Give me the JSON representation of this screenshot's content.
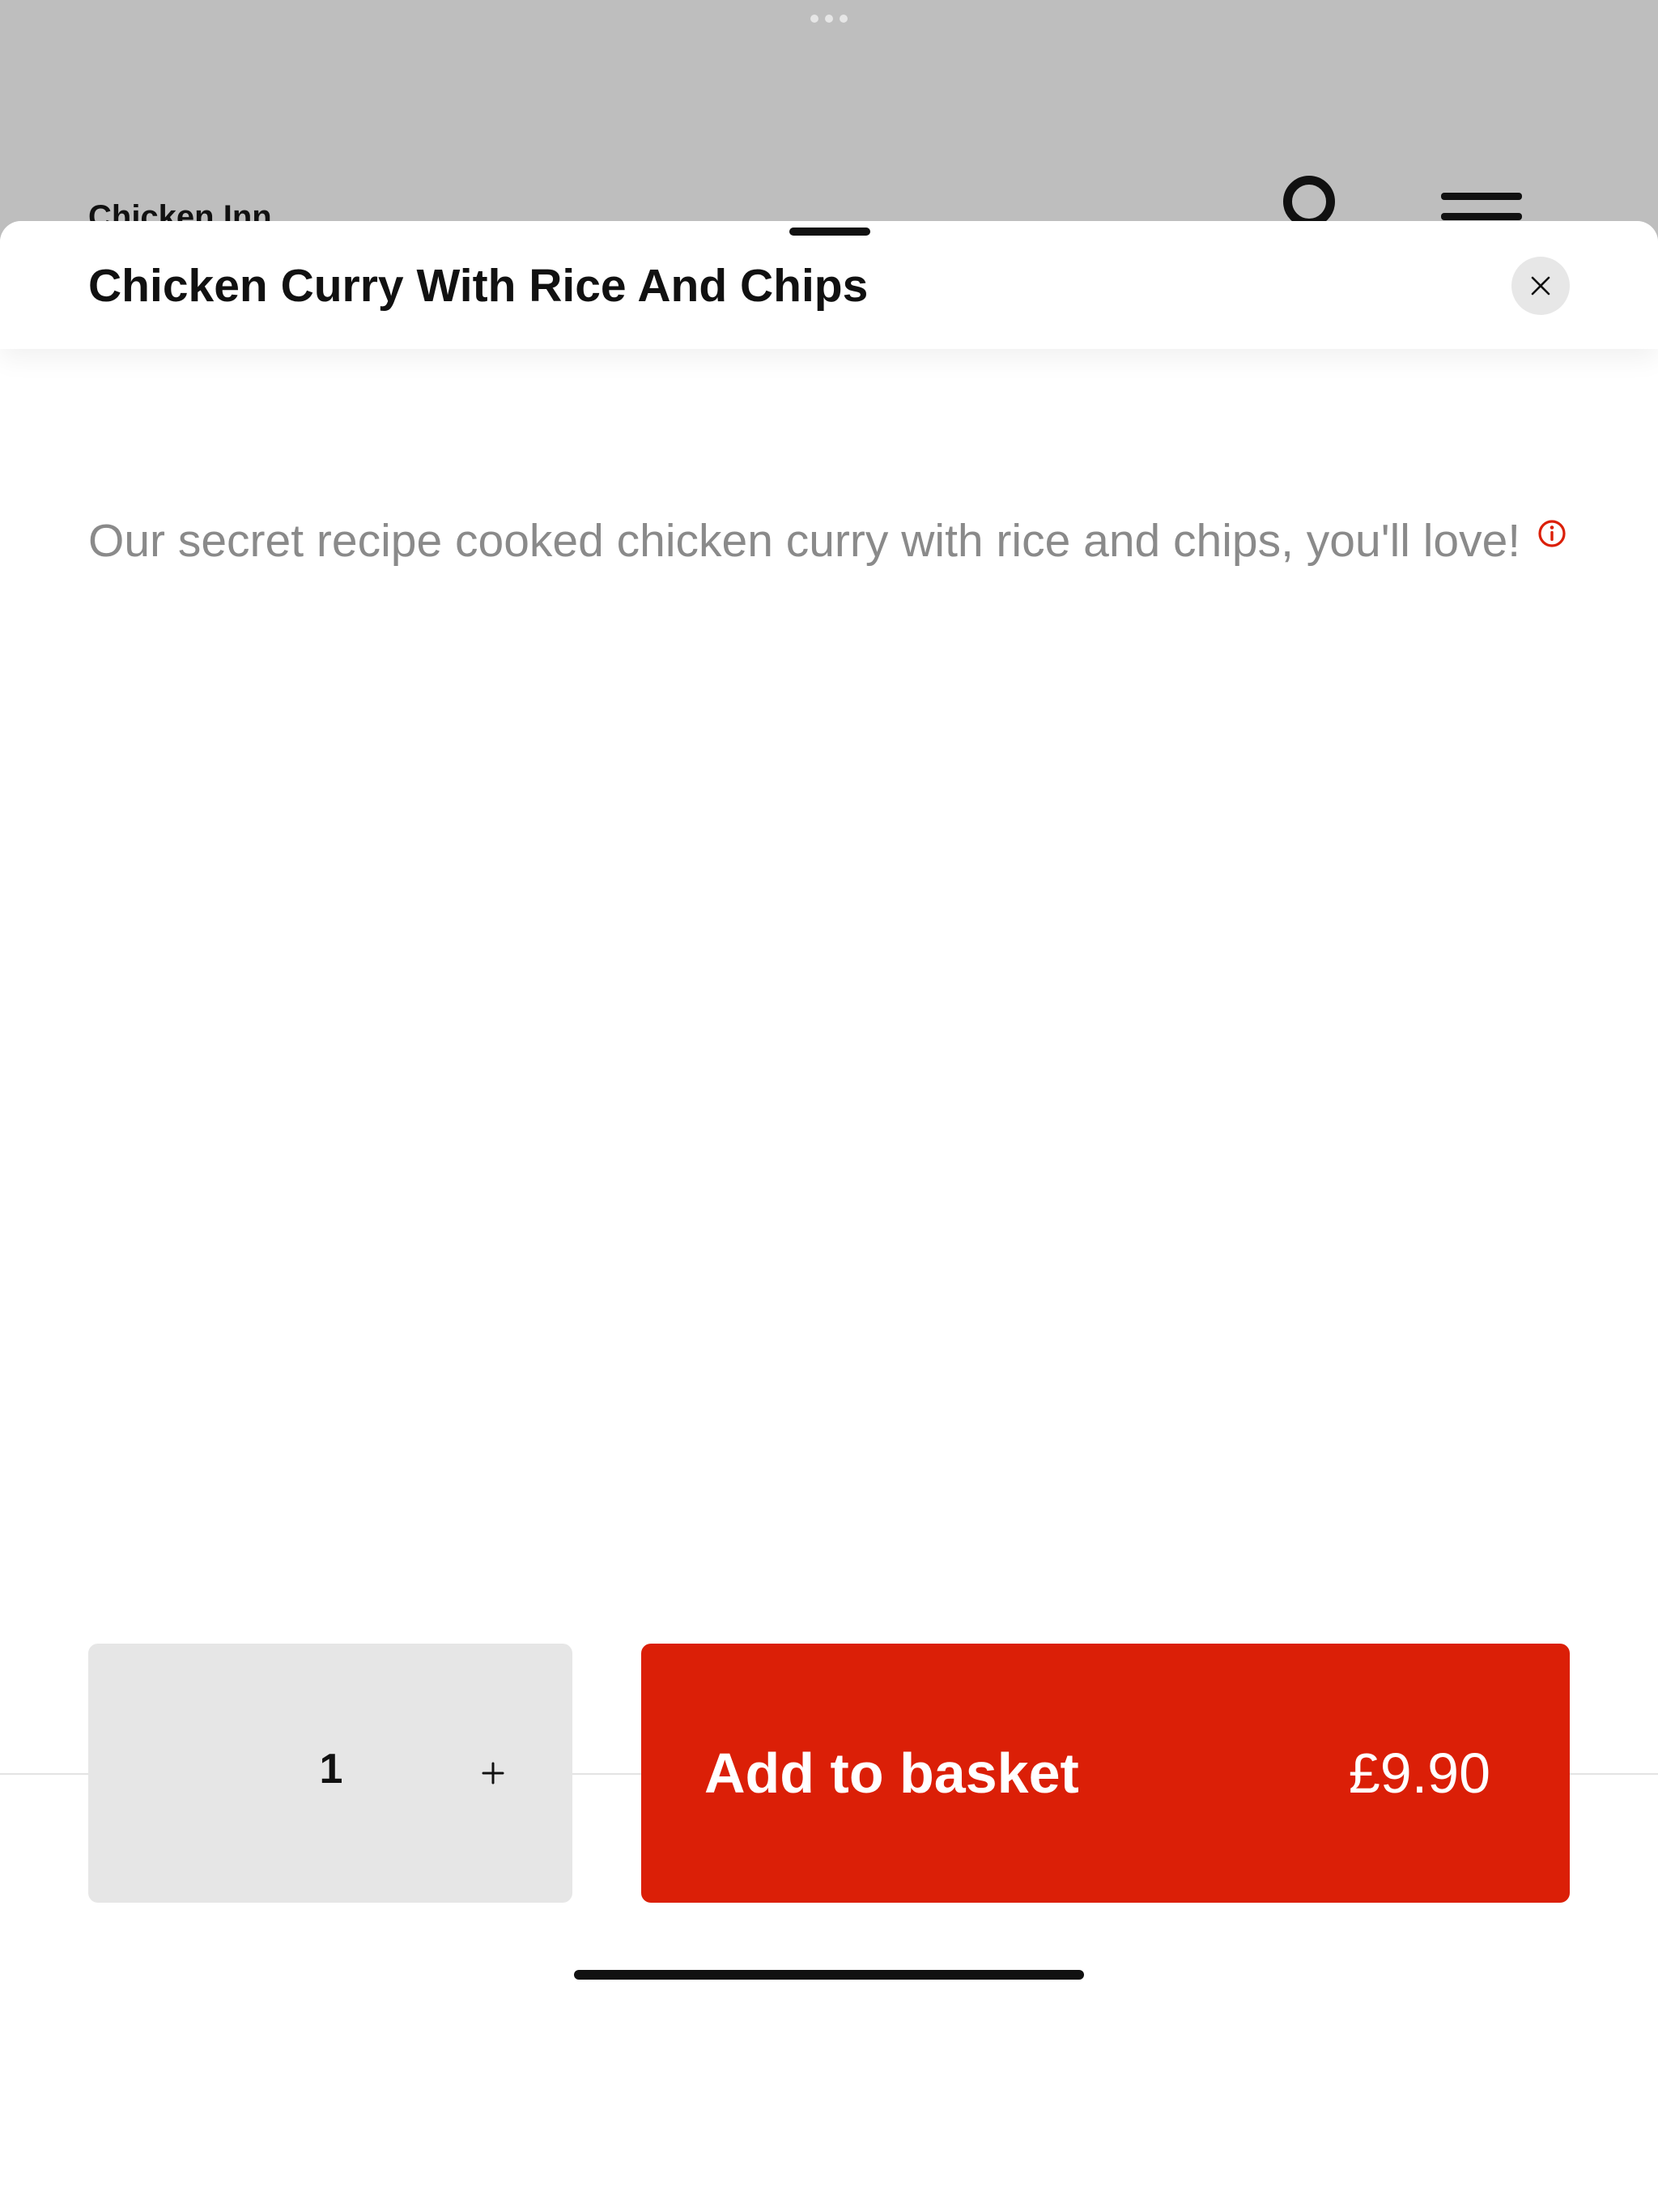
{
  "background_page": {
    "store_name": "Chicken Inn",
    "account_icon": "account-circle-icon",
    "menu_icon": "hamburger-menu-icon"
  },
  "modal": {
    "title": "Chicken Curry With Rice And Chips",
    "close_icon": "close-icon",
    "description": "Our secret recipe cooked chicken curry with rice and chips, you'll love!",
    "info_icon": "info-icon",
    "info_icon_color": "#db1f07"
  },
  "footer": {
    "quantity": "1",
    "increment_label": "+",
    "add_label": "Add to basket",
    "price": "£9.90",
    "accent_color": "#db1f07"
  }
}
